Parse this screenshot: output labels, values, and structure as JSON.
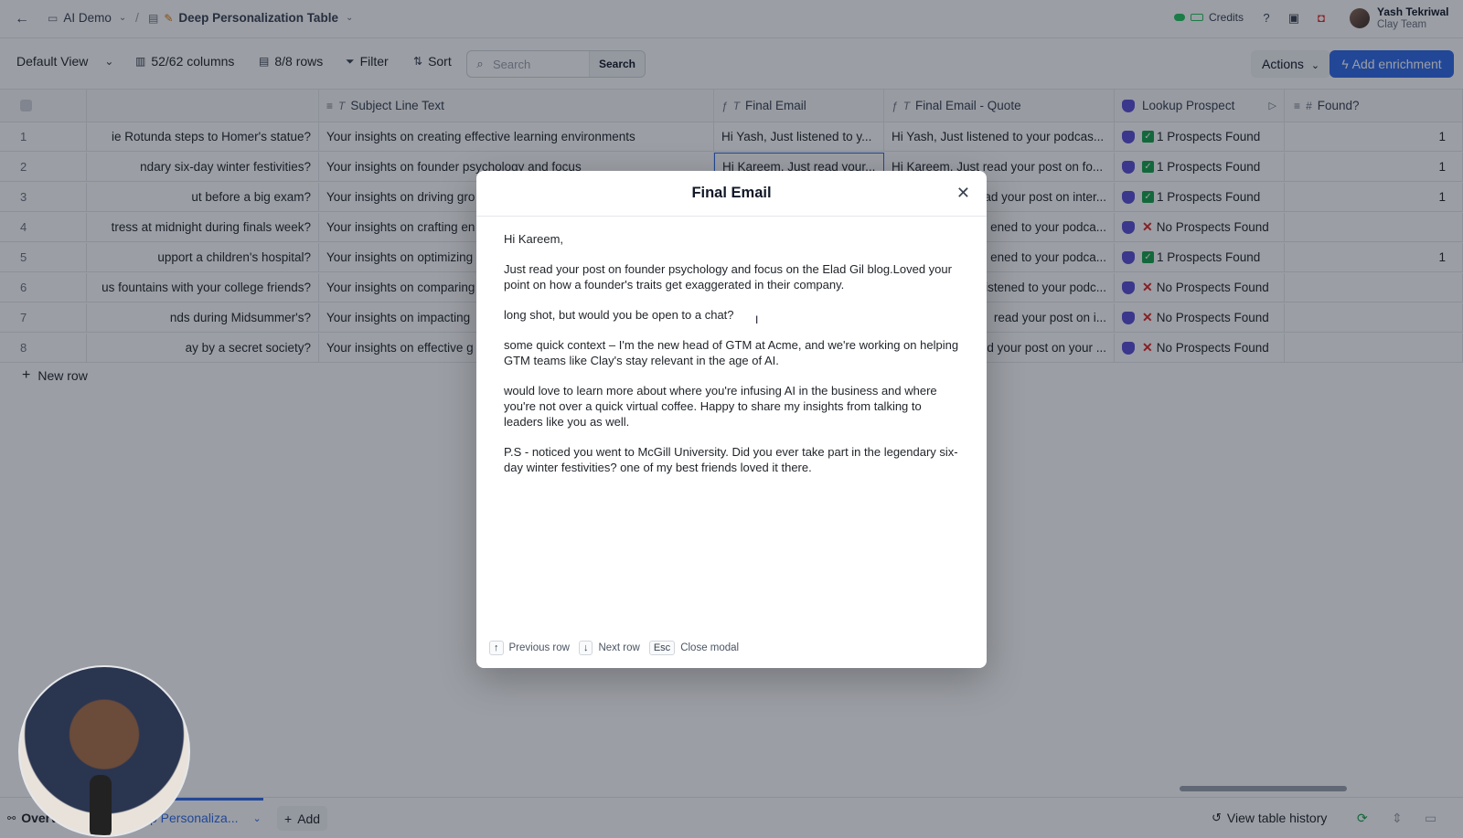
{
  "topbar": {
    "workspace": "AI Demo",
    "table_name": "Deep Personalization Table",
    "credits_label": "Credits",
    "user_name": "Yash Tekriwal",
    "user_team": "Clay Team"
  },
  "toolbar": {
    "view": "Default View",
    "columns": "52/62 columns",
    "rows": "8/8 rows",
    "filter": "Filter",
    "sort": "Sort",
    "search_placeholder": "Search",
    "search_button": "Search",
    "actions": "Actions",
    "add_enrichment": "Add enrichment"
  },
  "columns": [
    "Subject Line Text",
    "Final Email",
    "Final Email - Quote",
    "Lookup Prospect",
    "Found?"
  ],
  "rows": [
    {
      "num": "1",
      "q": "ie Rotunda steps to Homer's statue?",
      "subject": "Your insights on creating effective learning environments",
      "fe": "Hi Yash, Just listened to y...",
      "feq": "Hi Yash, Just listened to your podcas...",
      "status": "ok",
      "lp": "1 Prospects Found",
      "found": "1"
    },
    {
      "num": "2",
      "q": "ndary six-day winter festivities?",
      "subject": "Your insights on founder psychology and focus",
      "fe": "Hi Kareem, Just read your...",
      "feq": "Hi Kareem, Just read your post on fo...",
      "status": "ok",
      "lp": "1 Prospects Found",
      "found": "1"
    },
    {
      "num": "3",
      "q": "ut before a big exam?",
      "subject": "Your insights on driving gro",
      "fe": "",
      "feq": "ad your post on inter...",
      "status": "ok",
      "lp": "1 Prospects Found",
      "found": "1"
    },
    {
      "num": "4",
      "q": "tress at midnight during finals week?",
      "subject": "Your insights on crafting en",
      "fe": "",
      "feq": "ened to your podca...",
      "status": "no",
      "lp": "No Prospects Found",
      "found": ""
    },
    {
      "num": "5",
      "q": "upport a children's hospital?",
      "subject": "Your insights on optimizing",
      "fe": "",
      "feq": "ened to your podca...",
      "status": "ok",
      "lp": "1 Prospects Found",
      "found": "1"
    },
    {
      "num": "6",
      "q": "us fountains with your college friends?",
      "subject": "Your insights on comparing",
      "fe": "",
      "feq": "istened to your podc...",
      "status": "no",
      "lp": "No Prospects Found",
      "found": ""
    },
    {
      "num": "7",
      "q": "nds during Midsummer's?",
      "subject": "Your insights on impacting",
      "fe": "",
      "feq": "read your post on i...",
      "status": "no",
      "lp": "No Prospects Found",
      "found": ""
    },
    {
      "num": "8",
      "q": "ay by a secret society?",
      "subject": "Your insights on effective g",
      "fe": "",
      "feq": "d your post on your ...",
      "status": "no",
      "lp": "No Prospects Found",
      "found": ""
    }
  ],
  "new_row": "New row",
  "modal": {
    "title": "Final Email",
    "greeting": "Hi Kareem,",
    "p1": "Just read your post on founder psychology and focus on the Elad Gil blog.Loved your point on how a founder's traits get exaggerated in their company.",
    "p2": "long shot, but would you be open to a chat?",
    "p3": "some quick context – I'm the new head of GTM at Acme, and we're working on helping GTM teams like Clay's stay relevant in the age of AI.",
    "p4": "would love to learn more about where you're infusing AI in the business and where you're not over a quick virtual coffee. Happy to share my insights from talking to leaders like you as well.",
    "p5": "P.S - noticed you went to McGill University. Did you ever take part in the legendary six-day winter festivities? one of my best friends loved it there.",
    "kbd_prev": "↑",
    "prev_label": "Previous row",
    "kbd_next": "↓",
    "next_label": "Next row",
    "kbd_esc": "Esc",
    "esc_label": "Close modal"
  },
  "bottombar": {
    "overview": "Overv",
    "tab": "p Personaliza...",
    "add": "Add",
    "history": "View table history"
  },
  "colors": {
    "accent": "#2f6ae8",
    "ok": "#16a34a",
    "no": "#dc2626",
    "shield": "#5b4fd6"
  }
}
